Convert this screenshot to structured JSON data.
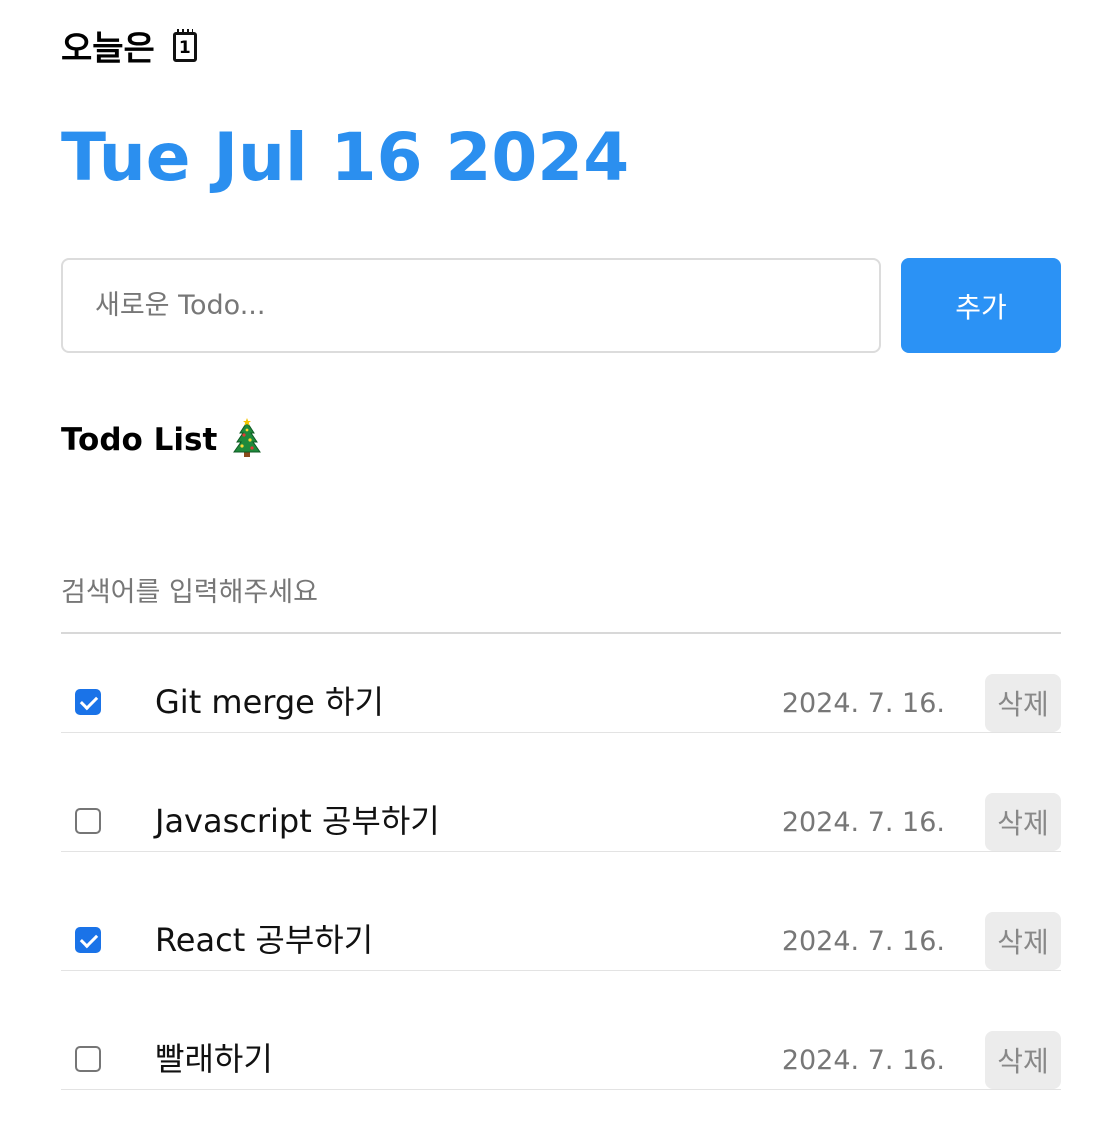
{
  "header": {
    "title": "오늘은",
    "calendar_icon_number": "1",
    "date": "Tue Jul 16 2024"
  },
  "editor": {
    "placeholder": "새로운 Todo...",
    "value": "",
    "add_label": "추가"
  },
  "list": {
    "title": "Todo List",
    "search_placeholder": "검색어를 입력해주세요",
    "search_value": "",
    "delete_label": "삭제",
    "items": [
      {
        "content": "Git merge 하기",
        "date": "2024. 7. 16.",
        "done": true
      },
      {
        "content": "Javascript 공부하기",
        "date": "2024. 7. 16.",
        "done": false
      },
      {
        "content": "React 공부하기",
        "date": "2024. 7. 16.",
        "done": true
      },
      {
        "content": "빨래하기",
        "date": "2024. 7. 16.",
        "done": false
      }
    ]
  },
  "colors": {
    "accent": "#2b8fef",
    "button": "#2b92f5",
    "checkbox_checked": "#1a73e8"
  }
}
